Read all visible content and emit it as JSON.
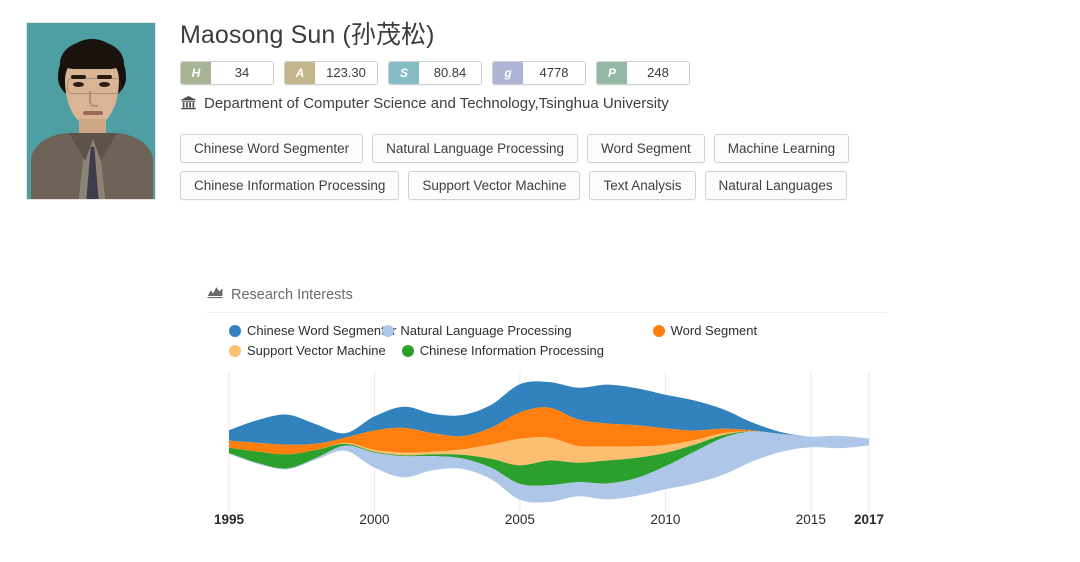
{
  "scholar": {
    "name": "Maosong Sun (孙茂松)",
    "photo_alt": "scholar-portrait",
    "metrics": [
      {
        "key": "H",
        "value": "34",
        "key_color": "#a7b596",
        "name": "h-index"
      },
      {
        "key": "A",
        "value": "123.30",
        "key_color": "#c3b68c",
        "name": "a-index"
      },
      {
        "key": "S",
        "value": "80.84",
        "key_color": "#85bdc4",
        "name": "s-index"
      },
      {
        "key": "g",
        "value": "4778",
        "key_color": "#adb4d6",
        "name": "g-index"
      },
      {
        "key": "P",
        "value": "248",
        "key_color": "#93b8a4",
        "name": "publications"
      }
    ],
    "affiliation_icon": "bank-icon",
    "affiliation": "Department of Computer Science and Technology,Tsinghua University",
    "tag_rows": [
      [
        "Chinese Word Segmenter",
        "Natural Language Processing",
        "Word Segment",
        "Machine Learning"
      ],
      [
        "Chinese Information Processing",
        "Support Vector Machine",
        "Text Analysis",
        "Natural Languages"
      ]
    ]
  },
  "interests_panel": {
    "icon": "area-chart-icon",
    "title": "Research Interests"
  },
  "chart_data": {
    "type": "area",
    "title": "Research Interests",
    "xlabel": "",
    "ylabel": "",
    "grid": true,
    "legend_position": "top",
    "stacked": "streamgraph",
    "xlim": [
      1995,
      2017
    ],
    "tick_labels": [
      "1995",
      "2000",
      "2005",
      "2010",
      "2015",
      "2017"
    ],
    "tick_values": [
      1995,
      2000,
      2005,
      2010,
      2015,
      2017
    ],
    "bold_ticks": [
      "1995",
      "2017"
    ],
    "x": [
      1995,
      1996,
      1997,
      1998,
      1999,
      2000,
      2001,
      2002,
      2003,
      2004,
      2005,
      2006,
      2007,
      2008,
      2009,
      2010,
      2011,
      2012,
      2013,
      2014,
      2015,
      2016,
      2017
    ],
    "series": [
      {
        "name": "Chinese Word Segmenter",
        "color": "#3182bd",
        "values": [
          1.2,
          2.6,
          3.4,
          2.2,
          0.5,
          1.6,
          2.4,
          2.2,
          2.4,
          2.6,
          3.2,
          2.9,
          3.6,
          4.4,
          4.2,
          3.8,
          3.4,
          2.2,
          0.9,
          0.2,
          0.0,
          0.0,
          0.0
        ]
      },
      {
        "name": "Natural Language Processing",
        "color": "#aec7e8",
        "values": [
          0.1,
          0.1,
          0.1,
          0.2,
          0.6,
          1.7,
          2.4,
          1.6,
          1.2,
          1.3,
          1.8,
          1.9,
          1.6,
          1.8,
          2.0,
          2.6,
          3.6,
          4.2,
          3.4,
          2.0,
          1.2,
          1.4,
          0.8
        ]
      },
      {
        "name": "Word Segment",
        "color": "#ff7f0e",
        "values": [
          0.8,
          1.0,
          1.1,
          0.7,
          0.6,
          2.2,
          2.8,
          2.1,
          1.5,
          1.9,
          3.0,
          3.4,
          3.0,
          2.6,
          2.4,
          1.9,
          1.1,
          0.5,
          0.1,
          0.0,
          0.0,
          0.0,
          0.0
        ]
      },
      {
        "name": "Support Vector Machine",
        "color": "#fdbe72",
        "values": [
          0.0,
          0.0,
          0.0,
          0.0,
          0.1,
          0.2,
          0.3,
          0.3,
          0.6,
          1.6,
          3.0,
          2.6,
          1.9,
          1.6,
          1.3,
          0.9,
          0.5,
          0.2,
          0.0,
          0.0,
          0.0,
          0.0,
          0.0
        ]
      },
      {
        "name": "Chinese Information Processing",
        "color": "#2ca02c",
        "values": [
          0.6,
          1.3,
          1.6,
          0.9,
          0.2,
          0.1,
          0.1,
          0.2,
          0.4,
          1.0,
          2.1,
          2.8,
          2.2,
          2.6,
          2.3,
          1.5,
          0.8,
          0.3,
          0.0,
          0.0,
          0.0,
          0.0,
          0.0
        ]
      }
    ]
  }
}
